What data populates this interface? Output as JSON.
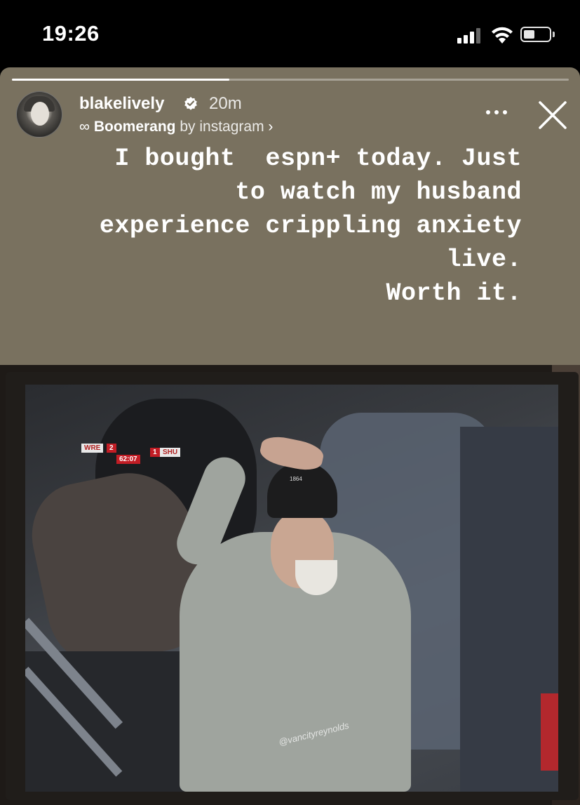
{
  "status_bar": {
    "time": "19:26",
    "battery_level": 0.45
  },
  "story": {
    "progress": 0.39,
    "username": "blakelively",
    "verified": true,
    "time_ago": "20m",
    "effect_symbol": "∞",
    "effect_name": "Boomerang",
    "effect_by": "by instagram",
    "effect_chevron": "›",
    "caption_lines": [
      "I bought  espn+ today. Just",
      "to watch my husband",
      "experience crippling anxiety",
      "live.",
      "",
      "Worth it."
    ],
    "icons": [
      "more-options-icon",
      "close-icon",
      "verified-badge-icon"
    ]
  },
  "photo": {
    "scoreboard": {
      "home": "WRE",
      "home_score": "2",
      "clock": "62:07",
      "away_score": "1",
      "away": "SHU"
    },
    "beanie_text": "1864",
    "watermark": "@vancityreynolds"
  },
  "colors": {
    "story_bg": "#79715f",
    "status_bg": "#000000"
  }
}
